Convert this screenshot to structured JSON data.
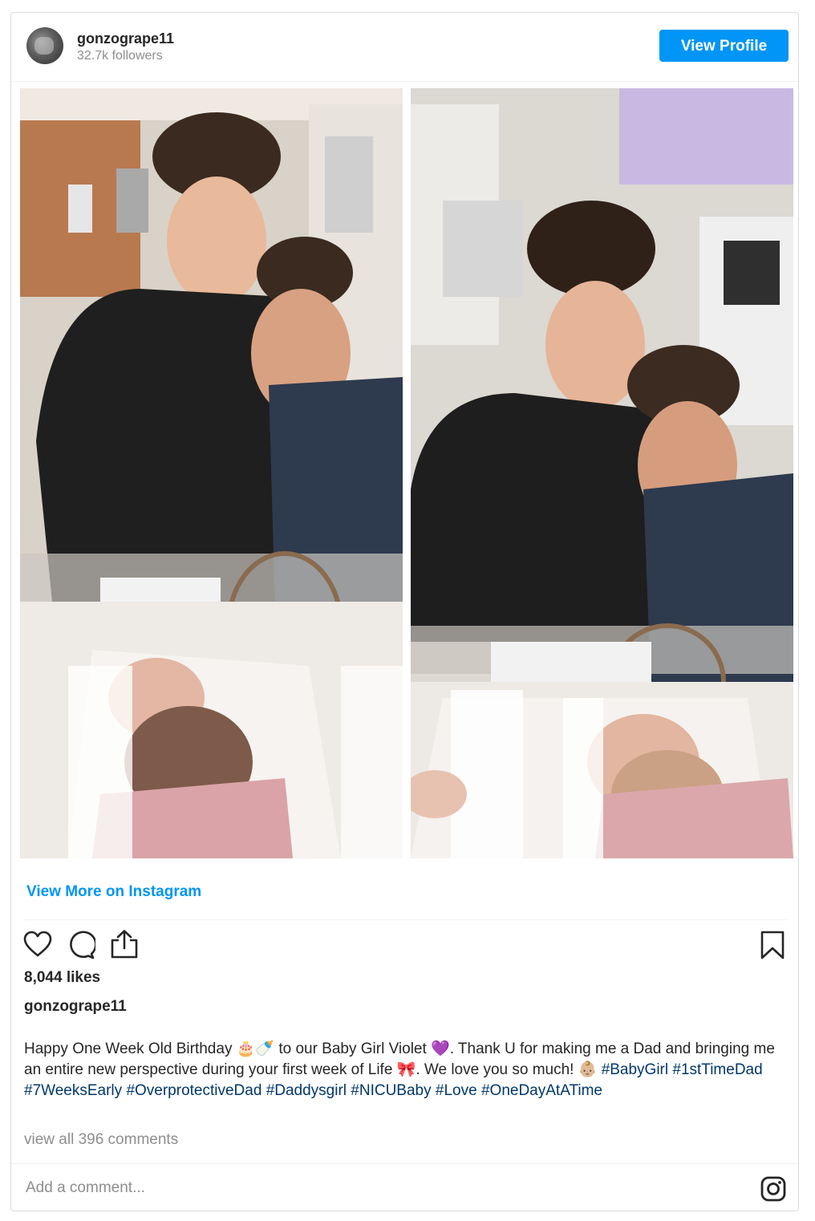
{
  "post": {
    "username": "gonzogrape11",
    "followers": "32.7k followers",
    "view_profile": "View Profile",
    "view_more": "View More on Instagram",
    "likes": "8,044 likes",
    "caption_user": "gonzogrape11",
    "caption_parts": [
      "Happy One Week Old Birthday 🎂🍼 to our Baby Girl Violet 💜. Thank U for making me a Dad and bringing me an entire new perspective during your first week of Life 🎀. We love you so much! 👶🏼 ",
      "#BabyGirl",
      "#1stTimeDad",
      "#7WeeksEarly",
      "#OverprotectiveDad",
      "#Daddysgirl",
      "#NICUBaby",
      "#Love",
      "#OneDayAtATime"
    ],
    "comments": "view all 396 comments",
    "comment_placeholder": "Add a comment..."
  },
  "icons": {
    "like": "heart-icon",
    "comment": "comment-icon",
    "share": "share-icon",
    "save": "bookmark-icon",
    "instagram": "instagram-logo-icon"
  },
  "colors": {
    "accent": "#0095f6",
    "hashtag": "#00376b",
    "muted": "#8e8e8e",
    "text": "#262626"
  }
}
